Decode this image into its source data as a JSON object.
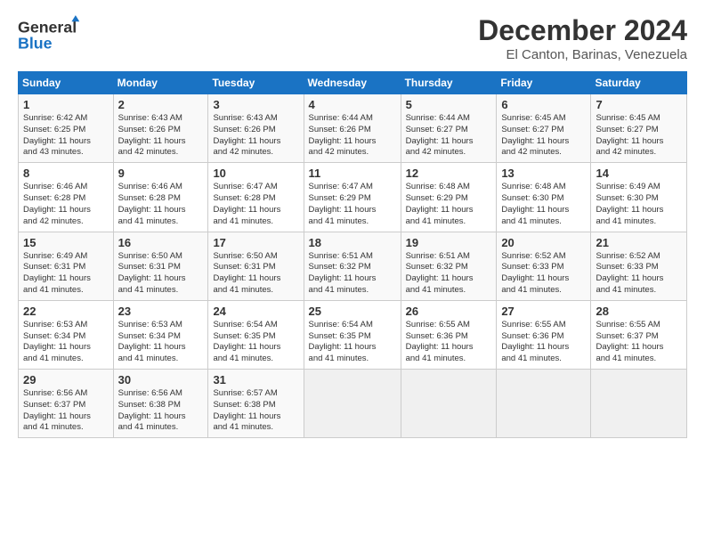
{
  "logo": {
    "line1": "General",
    "line2": "Blue"
  },
  "header": {
    "title": "December 2024",
    "subtitle": "El Canton, Barinas, Venezuela"
  },
  "weekdays": [
    "Sunday",
    "Monday",
    "Tuesday",
    "Wednesday",
    "Thursday",
    "Friday",
    "Saturday"
  ],
  "weeks": [
    [
      {
        "day": "1",
        "info": "Sunrise: 6:42 AM\nSunset: 6:25 PM\nDaylight: 11 hours\nand 43 minutes."
      },
      {
        "day": "2",
        "info": "Sunrise: 6:43 AM\nSunset: 6:26 PM\nDaylight: 11 hours\nand 42 minutes."
      },
      {
        "day": "3",
        "info": "Sunrise: 6:43 AM\nSunset: 6:26 PM\nDaylight: 11 hours\nand 42 minutes."
      },
      {
        "day": "4",
        "info": "Sunrise: 6:44 AM\nSunset: 6:26 PM\nDaylight: 11 hours\nand 42 minutes."
      },
      {
        "day": "5",
        "info": "Sunrise: 6:44 AM\nSunset: 6:27 PM\nDaylight: 11 hours\nand 42 minutes."
      },
      {
        "day": "6",
        "info": "Sunrise: 6:45 AM\nSunset: 6:27 PM\nDaylight: 11 hours\nand 42 minutes."
      },
      {
        "day": "7",
        "info": "Sunrise: 6:45 AM\nSunset: 6:27 PM\nDaylight: 11 hours\nand 42 minutes."
      }
    ],
    [
      {
        "day": "8",
        "info": "Sunrise: 6:46 AM\nSunset: 6:28 PM\nDaylight: 11 hours\nand 42 minutes."
      },
      {
        "day": "9",
        "info": "Sunrise: 6:46 AM\nSunset: 6:28 PM\nDaylight: 11 hours\nand 41 minutes."
      },
      {
        "day": "10",
        "info": "Sunrise: 6:47 AM\nSunset: 6:28 PM\nDaylight: 11 hours\nand 41 minutes."
      },
      {
        "day": "11",
        "info": "Sunrise: 6:47 AM\nSunset: 6:29 PM\nDaylight: 11 hours\nand 41 minutes."
      },
      {
        "day": "12",
        "info": "Sunrise: 6:48 AM\nSunset: 6:29 PM\nDaylight: 11 hours\nand 41 minutes."
      },
      {
        "day": "13",
        "info": "Sunrise: 6:48 AM\nSunset: 6:30 PM\nDaylight: 11 hours\nand 41 minutes."
      },
      {
        "day": "14",
        "info": "Sunrise: 6:49 AM\nSunset: 6:30 PM\nDaylight: 11 hours\nand 41 minutes."
      }
    ],
    [
      {
        "day": "15",
        "info": "Sunrise: 6:49 AM\nSunset: 6:31 PM\nDaylight: 11 hours\nand 41 minutes."
      },
      {
        "day": "16",
        "info": "Sunrise: 6:50 AM\nSunset: 6:31 PM\nDaylight: 11 hours\nand 41 minutes."
      },
      {
        "day": "17",
        "info": "Sunrise: 6:50 AM\nSunset: 6:31 PM\nDaylight: 11 hours\nand 41 minutes."
      },
      {
        "day": "18",
        "info": "Sunrise: 6:51 AM\nSunset: 6:32 PM\nDaylight: 11 hours\nand 41 minutes."
      },
      {
        "day": "19",
        "info": "Sunrise: 6:51 AM\nSunset: 6:32 PM\nDaylight: 11 hours\nand 41 minutes."
      },
      {
        "day": "20",
        "info": "Sunrise: 6:52 AM\nSunset: 6:33 PM\nDaylight: 11 hours\nand 41 minutes."
      },
      {
        "day": "21",
        "info": "Sunrise: 6:52 AM\nSunset: 6:33 PM\nDaylight: 11 hours\nand 41 minutes."
      }
    ],
    [
      {
        "day": "22",
        "info": "Sunrise: 6:53 AM\nSunset: 6:34 PM\nDaylight: 11 hours\nand 41 minutes."
      },
      {
        "day": "23",
        "info": "Sunrise: 6:53 AM\nSunset: 6:34 PM\nDaylight: 11 hours\nand 41 minutes."
      },
      {
        "day": "24",
        "info": "Sunrise: 6:54 AM\nSunset: 6:35 PM\nDaylight: 11 hours\nand 41 minutes."
      },
      {
        "day": "25",
        "info": "Sunrise: 6:54 AM\nSunset: 6:35 PM\nDaylight: 11 hours\nand 41 minutes."
      },
      {
        "day": "26",
        "info": "Sunrise: 6:55 AM\nSunset: 6:36 PM\nDaylight: 11 hours\nand 41 minutes."
      },
      {
        "day": "27",
        "info": "Sunrise: 6:55 AM\nSunset: 6:36 PM\nDaylight: 11 hours\nand 41 minutes."
      },
      {
        "day": "28",
        "info": "Sunrise: 6:55 AM\nSunset: 6:37 PM\nDaylight: 11 hours\nand 41 minutes."
      }
    ],
    [
      {
        "day": "29",
        "info": "Sunrise: 6:56 AM\nSunset: 6:37 PM\nDaylight: 11 hours\nand 41 minutes."
      },
      {
        "day": "30",
        "info": "Sunrise: 6:56 AM\nSunset: 6:38 PM\nDaylight: 11 hours\nand 41 minutes."
      },
      {
        "day": "31",
        "info": "Sunrise: 6:57 AM\nSunset: 6:38 PM\nDaylight: 11 hours\nand 41 minutes."
      },
      {
        "day": "",
        "info": ""
      },
      {
        "day": "",
        "info": ""
      },
      {
        "day": "",
        "info": ""
      },
      {
        "day": "",
        "info": ""
      }
    ]
  ]
}
